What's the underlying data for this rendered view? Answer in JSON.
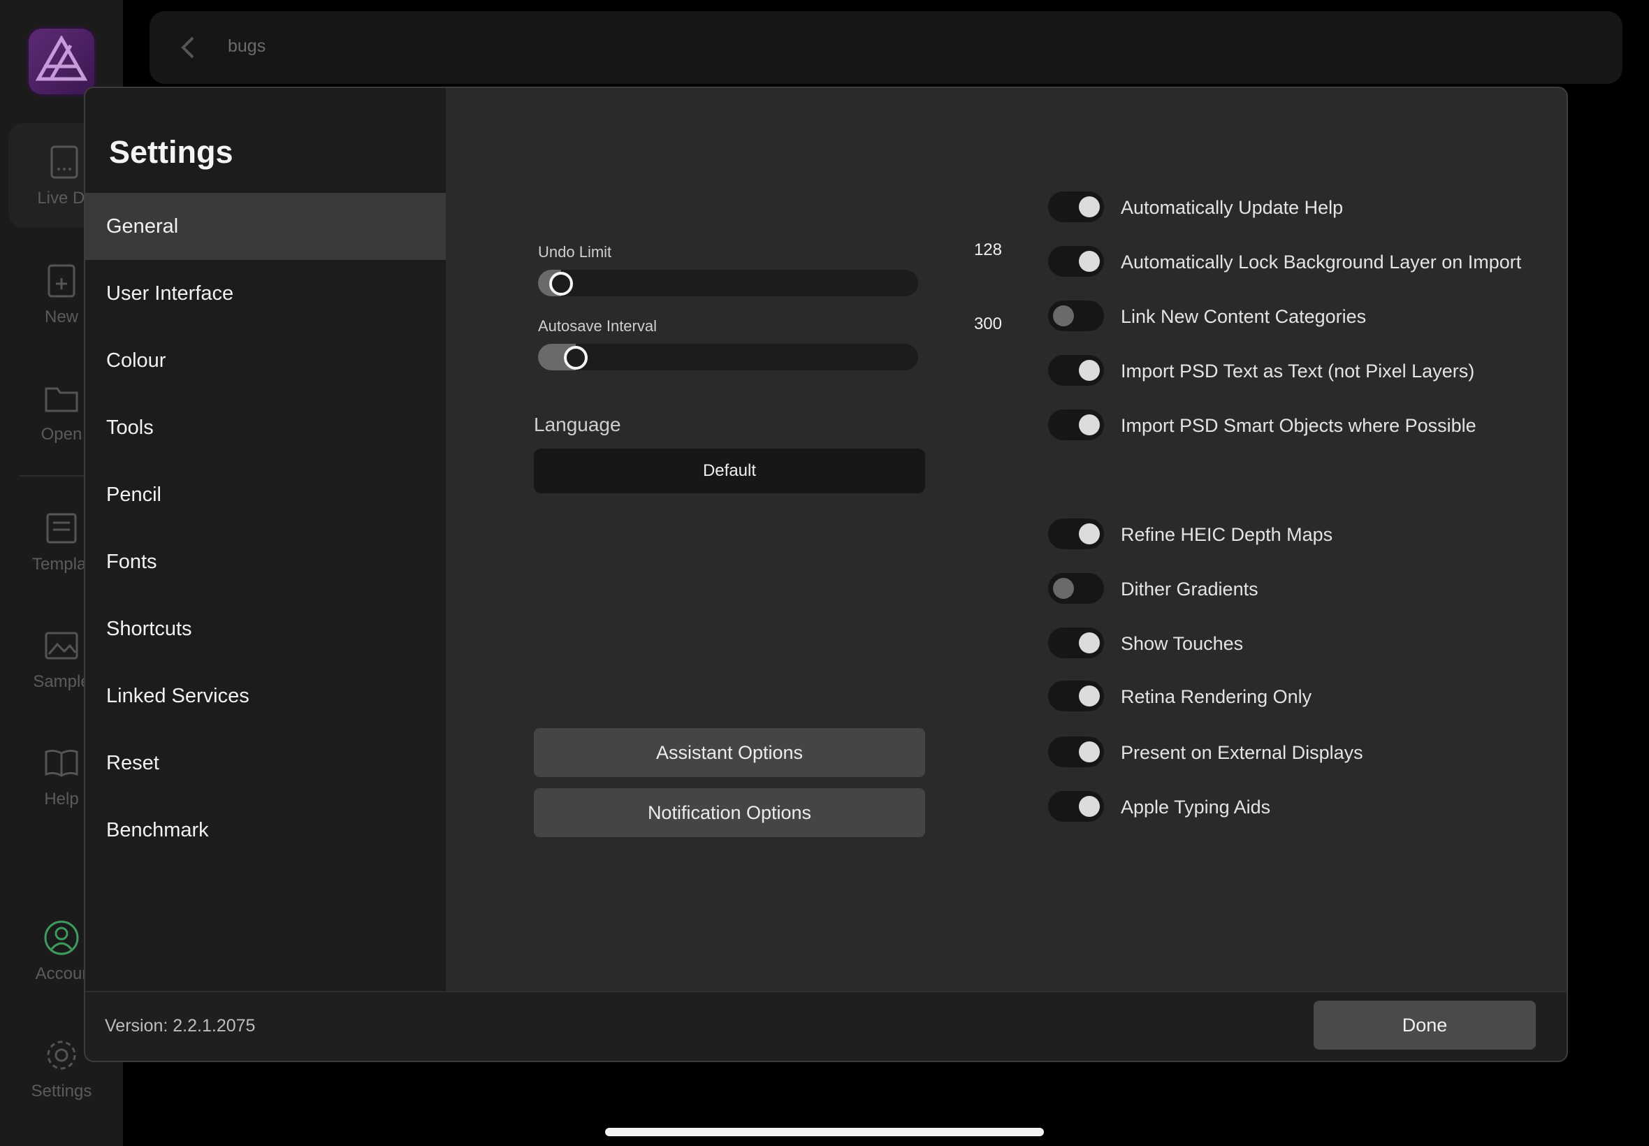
{
  "background": {
    "document_title": "bugs",
    "rail_items": [
      {
        "label": "Live Do",
        "icon": "live-document-icon"
      },
      {
        "label": "New",
        "icon": "new-document-icon"
      },
      {
        "label": "Open",
        "icon": "folder-icon"
      },
      {
        "label": "Templat",
        "icon": "template-icon"
      },
      {
        "label": "Sample",
        "icon": "image-icon"
      },
      {
        "label": "Help",
        "icon": "book-icon"
      },
      {
        "label": "Accour",
        "icon": "account-icon"
      },
      {
        "label": "Settings",
        "icon": "gear-icon"
      }
    ]
  },
  "settings": {
    "title": "Settings",
    "nav": [
      {
        "label": "General",
        "active": true
      },
      {
        "label": "User Interface",
        "active": false
      },
      {
        "label": "Colour",
        "active": false
      },
      {
        "label": "Tools",
        "active": false
      },
      {
        "label": "Pencil",
        "active": false
      },
      {
        "label": "Fonts",
        "active": false
      },
      {
        "label": "Shortcuts",
        "active": false
      },
      {
        "label": "Linked Services",
        "active": false
      },
      {
        "label": "Reset",
        "active": false
      },
      {
        "label": "Benchmark",
        "active": false
      }
    ],
    "sliders": [
      {
        "label": "Undo Limit",
        "value": "128",
        "fraction": 0.06
      },
      {
        "label": "Autosave Interval",
        "value": "300",
        "fraction": 0.1
      }
    ],
    "language": {
      "label": "Language",
      "value": "Default"
    },
    "buttons": {
      "assistant": "Assistant Options",
      "notification": "Notification Options",
      "done": "Done"
    },
    "toggles": [
      {
        "label": "Automatically Update Help",
        "on": true
      },
      {
        "label": "Automatically Lock Background Layer on Import",
        "on": true
      },
      {
        "label": "Link New Content Categories",
        "on": false
      },
      {
        "label": "Import PSD Text as Text (not Pixel Layers)",
        "on": true
      },
      {
        "label": "Import PSD Smart Objects where Possible",
        "on": true
      },
      {
        "label": "Refine HEIC Depth Maps",
        "on": true
      },
      {
        "label": "Dither Gradients",
        "on": false
      },
      {
        "label": "Show Touches",
        "on": true
      },
      {
        "label": "Retina Rendering Only",
        "on": true
      },
      {
        "label": "Present on External Displays",
        "on": true
      },
      {
        "label": "Apple Typing Aids",
        "on": true
      }
    ],
    "version": "Version: 2.2.1.2075"
  }
}
